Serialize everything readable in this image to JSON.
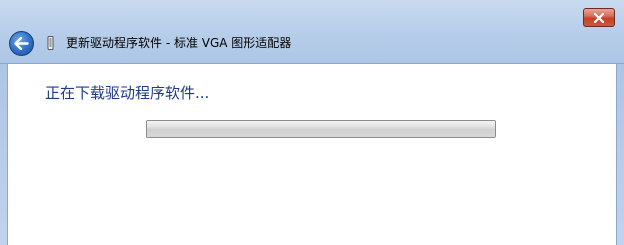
{
  "window": {
    "title": "更新驱动程序软件 - 标准 VGA 图形适配器",
    "close_icon": "close-icon",
    "back_icon": "back-arrow-icon",
    "device_icon": "display-adapter-icon",
    "close_color": "#c44128",
    "accent_color": "#2e6fc4"
  },
  "main": {
    "heading": "正在下载驱动程序软件...",
    "heading_color": "#1e3a8a",
    "progress": {
      "value": 1.0,
      "style": "marquee-idle"
    }
  }
}
